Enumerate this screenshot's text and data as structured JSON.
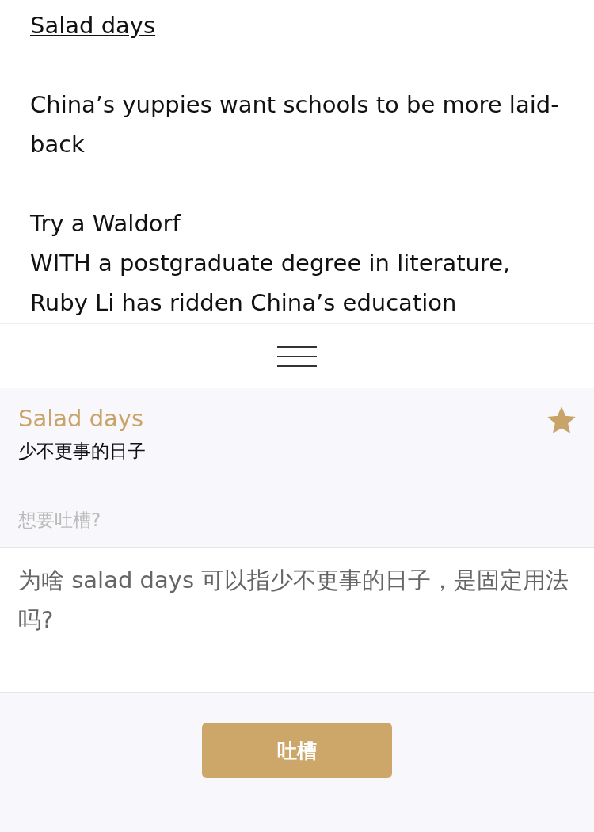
{
  "article": {
    "headline": "Salad days",
    "subtitle": "China’s yuppies want schools to be more laid-back",
    "section_title": "Try a Waldorf",
    "body": "WITH a postgraduate degree in literature, Ruby Li has ridden China’s education"
  },
  "note_panel": {
    "term": "Salad days",
    "translation": "少不更事的日子",
    "starred": true,
    "prompt": "想要吐槽?",
    "comment": {
      "value": "为啥 salad days 可以指少不更事的日子，是固定用法吗?"
    },
    "submit_button": "吐槽"
  }
}
